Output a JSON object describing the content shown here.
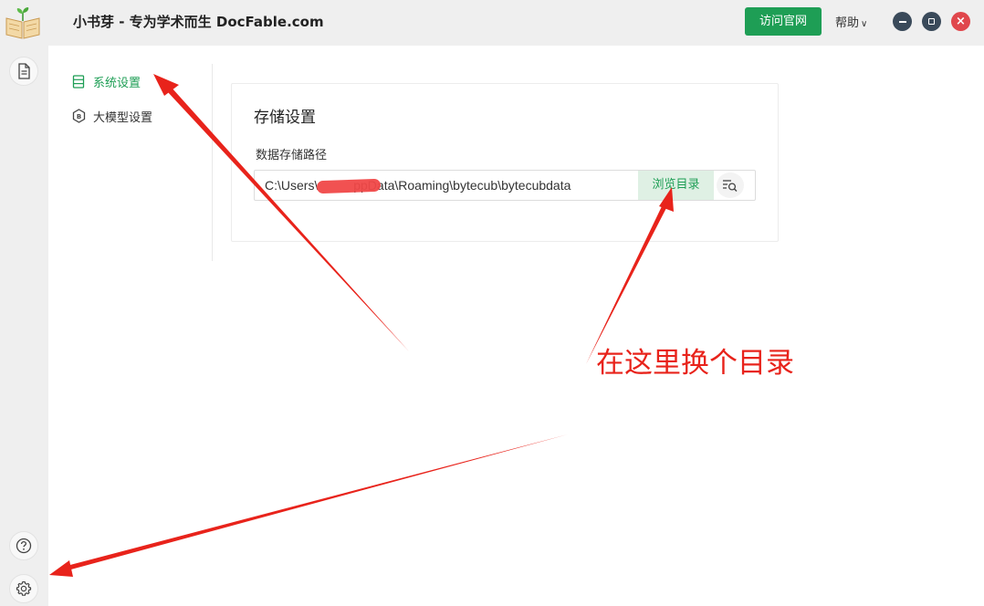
{
  "window": {
    "title": "小书芽 - 专为学术而生 DocFable.com",
    "visit_button": "访问官网",
    "help_menu": "帮助",
    "controls": {
      "minimize_icon": "minimize-icon",
      "maximize_icon": "maximize-icon",
      "close_icon": "close-icon"
    }
  },
  "colors": {
    "accent": "#1e9e55",
    "accent_light": "#dff0e4",
    "annotation": "#e8231b",
    "close": "#e0474c",
    "window_control": "#3a4a5a"
  },
  "sidebar": {
    "top_icon": "document-icon",
    "bottom_icons": [
      "help-circle-icon",
      "gear-icon"
    ]
  },
  "settings_menu": {
    "items": [
      {
        "label": "系统设置",
        "icon": "list-icon",
        "active": true
      },
      {
        "label": "大模型设置",
        "icon": "model-icon",
        "active": false
      }
    ]
  },
  "storage": {
    "title": "存储设置",
    "path_label": "数据存储路径",
    "path_value": "C:\\Users\\          ppData\\Roaming\\bytecub\\bytecubdata",
    "browse_button": "浏览目录",
    "open_button_icon": "list-search-icon"
  },
  "annotation": {
    "text": "在这里换个目录"
  }
}
